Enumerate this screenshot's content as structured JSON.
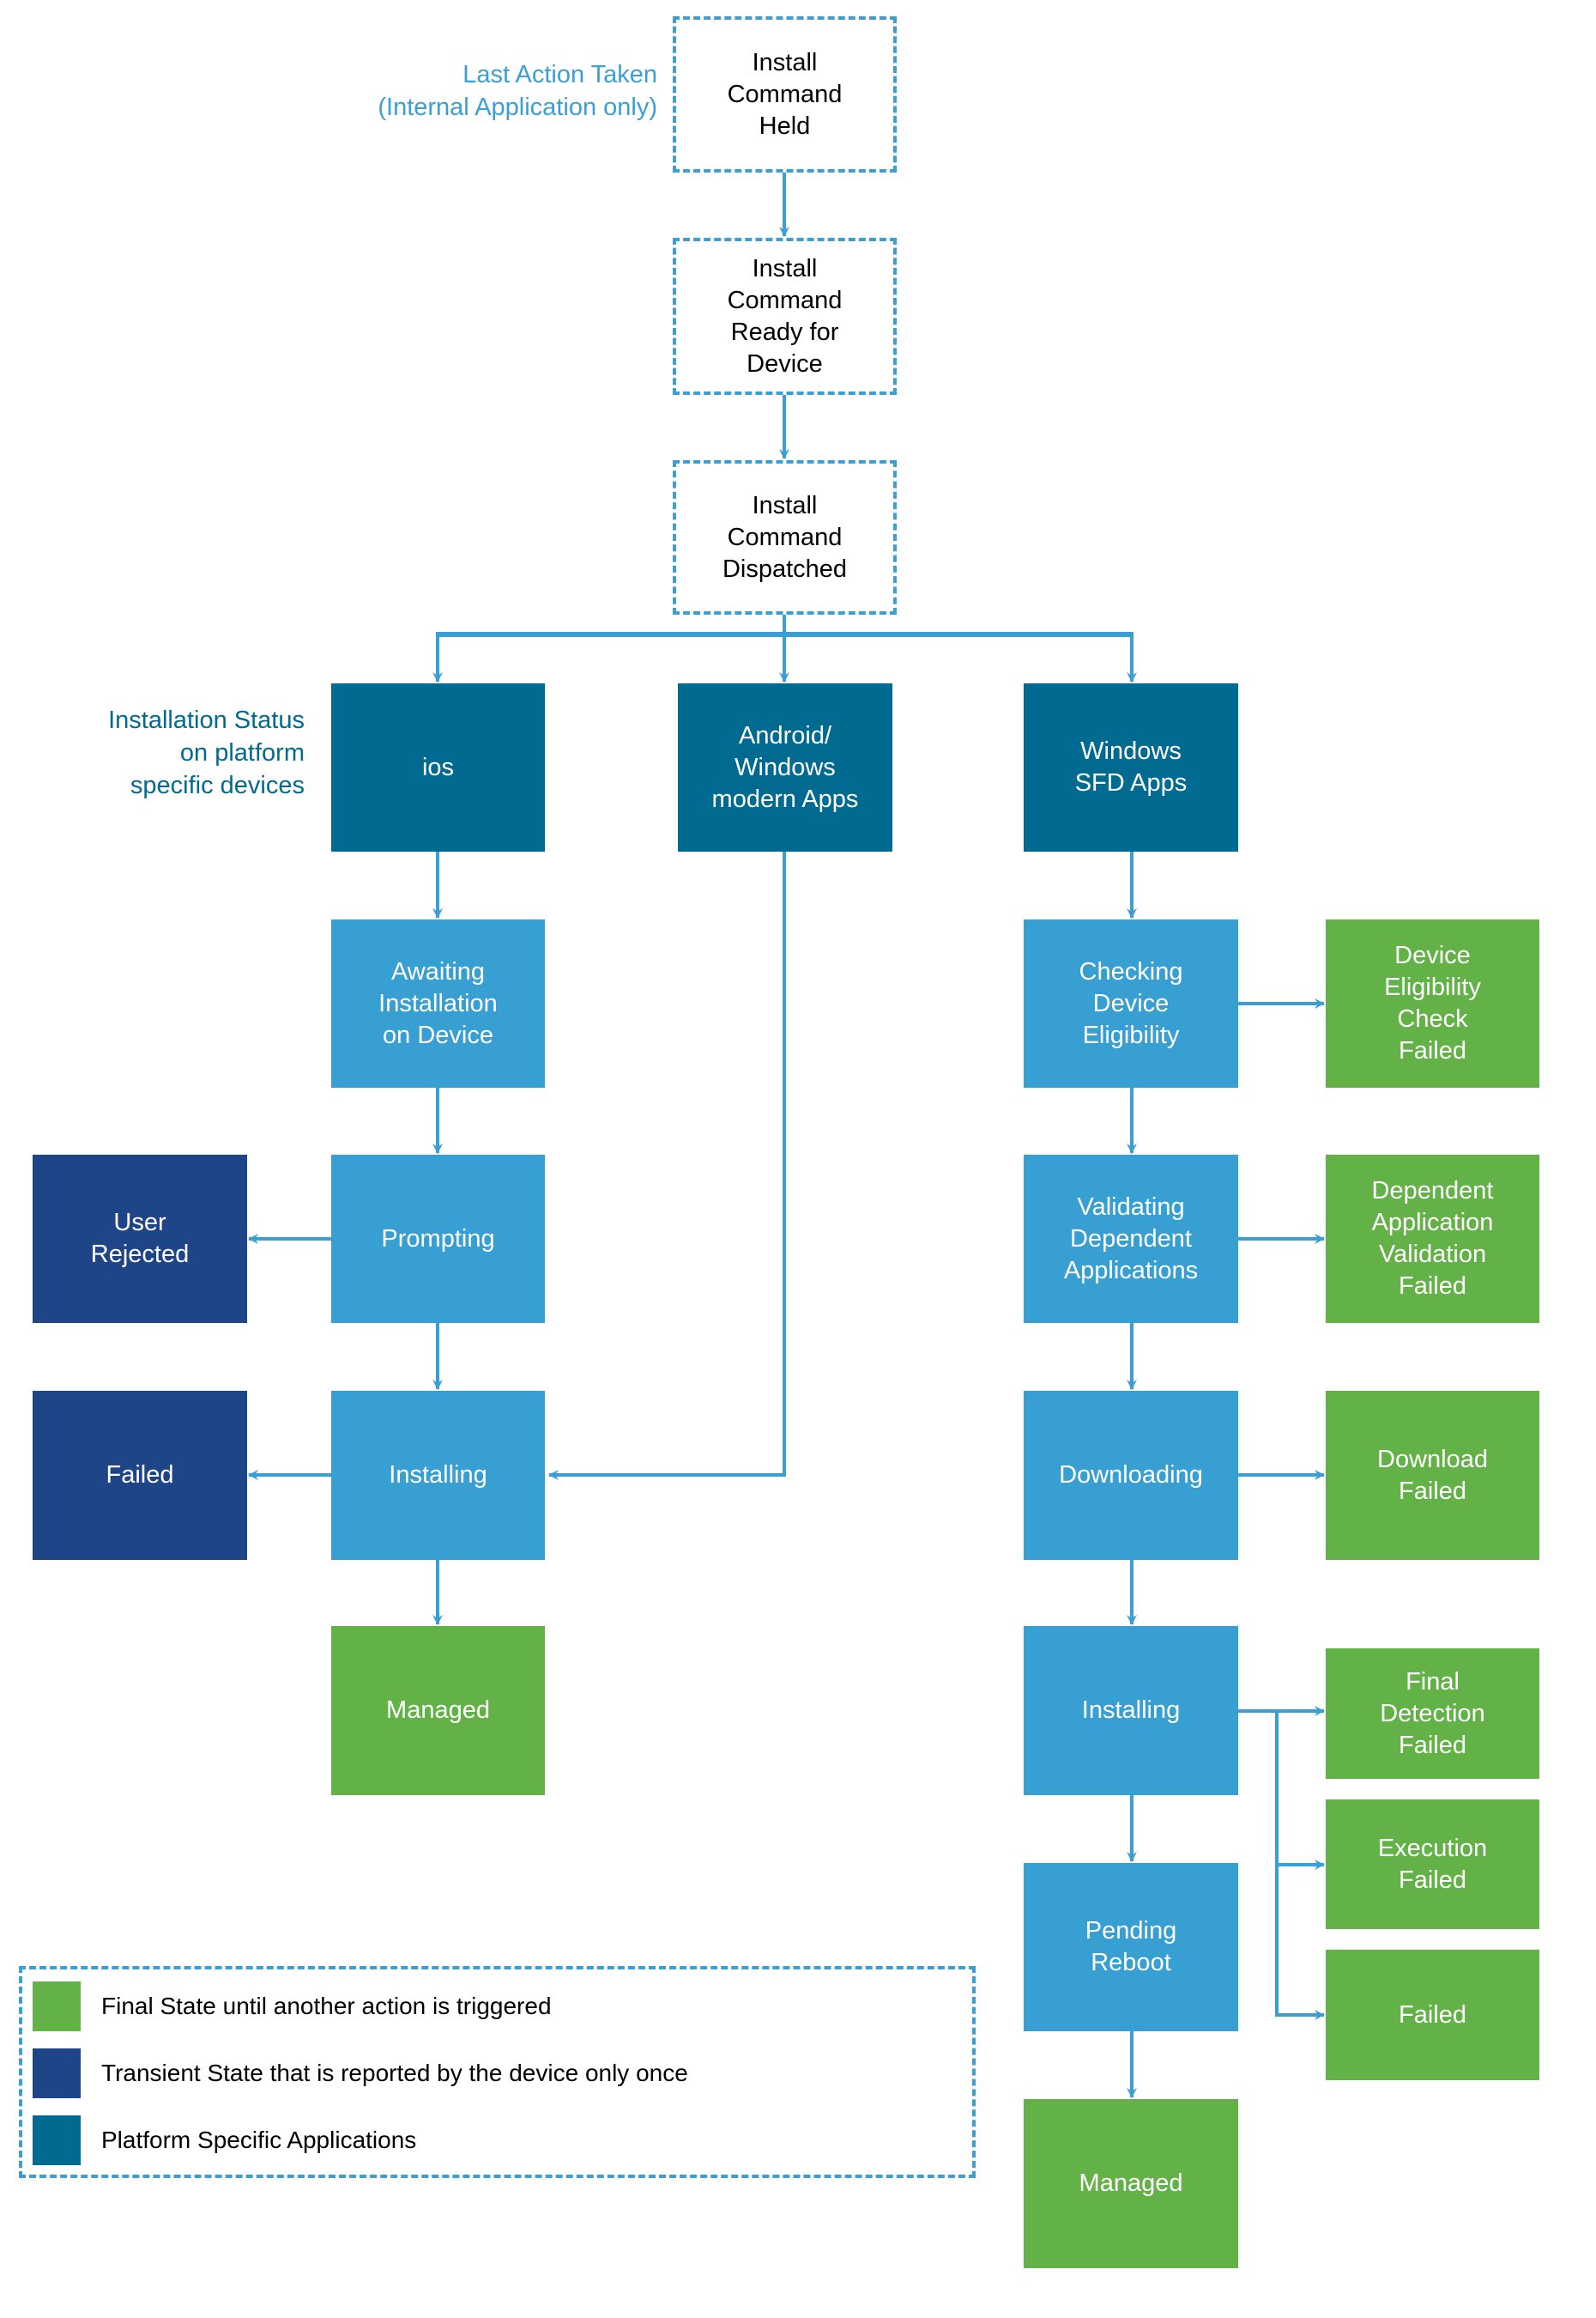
{
  "annotations": {
    "last_action": "Last Action Taken\n(Internal Application only)",
    "installation_status": "Installation Status\non platform\nspecific devices"
  },
  "colors": {
    "command_border": "#3a9fd4",
    "platform": "#006a91",
    "intermediate": "#389fd2",
    "transient": "#1e4588",
    "final": "#63b247"
  },
  "commands": [
    {
      "label": "Install\nCommand\nHeld"
    },
    {
      "label": "Install\nCommand\nReady for\nDevice"
    },
    {
      "label": "Install\nCommand\nDispatched"
    }
  ],
  "platforms": [
    {
      "label": "ios"
    },
    {
      "label": "Android/\nWindows\nmodern Apps"
    },
    {
      "label": "Windows\nSFD Apps"
    }
  ],
  "ios_flow": {
    "awaiting": "Awaiting\nInstallation\non Device",
    "prompting": "Prompting",
    "user_rejected": "User\nRejected",
    "installing": "Installing",
    "failed": "Failed",
    "managed": "Managed"
  },
  "windows_flow": {
    "checking": "Checking\nDevice\nEligibility",
    "eligibility_failed": "Device\nEligibility\nCheck\nFailed",
    "validating": "Validating\nDependent\nApplications",
    "validation_failed": "Dependent\nApplication\nValidation\nFailed",
    "downloading": "Downloading",
    "download_failed": "Download\nFailed",
    "installing": "Installing",
    "final_detection_failed": "Final\nDetection\nFailed",
    "execution_failed": "Execution\nFailed",
    "failed": "Failed",
    "pending_reboot": "Pending\nReboot",
    "managed": "Managed"
  },
  "legend": [
    {
      "label": "Final State until another action is triggered",
      "color": "#63b247"
    },
    {
      "label": "Transient State that is reported by the device only once",
      "color": "#1e4588"
    },
    {
      "label": "Platform Specific Applications",
      "color": "#006a91"
    }
  ]
}
